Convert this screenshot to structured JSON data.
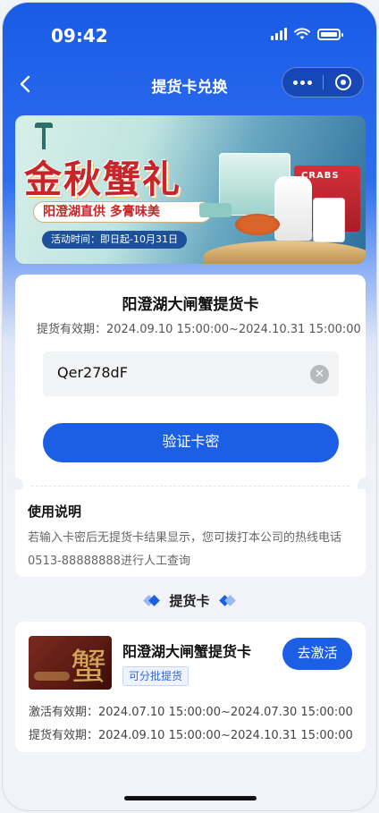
{
  "status_bar": {
    "time": "09:42"
  },
  "nav": {
    "title": "提货卡兑换"
  },
  "banner": {
    "title": "金秋蟹礼",
    "slogan": "阳澄湖直供 多膏味美",
    "date": "活动时间：即日起-10月31日",
    "box_label": "CRABS"
  },
  "main_card": {
    "title": "阳澄湖大闸蟹提货卡",
    "validity_label": "提货有效期：",
    "validity_value": "2024.09.10 15:00:00~2024.10.31 15:00:00",
    "code_value": "Qer278dF",
    "verify_label": "验证卡密"
  },
  "help": {
    "title": "使用说明",
    "text": "若输入卡密后无提货卡结果显示，您可拨打本公司的热线电话0513-88888888进行人工查询"
  },
  "section": {
    "label": "提货卡"
  },
  "pickup_card": {
    "name": "阳澄湖大闸蟹提货卡",
    "tag": "可分批提货",
    "activate_label": "去激活",
    "thumb_char": "蟹",
    "activation_label": "激活有效期：",
    "activation_value": "2024.07.10 15:00:00~2024.07.30 15:00:00",
    "pickup_label": "提货有效期：",
    "pickup_value": "2024.09.10 15:00:00~2024.10.31 15:00:00"
  },
  "colors": {
    "primary": "#1c5fe5",
    "banner_red": "#c8242a"
  }
}
